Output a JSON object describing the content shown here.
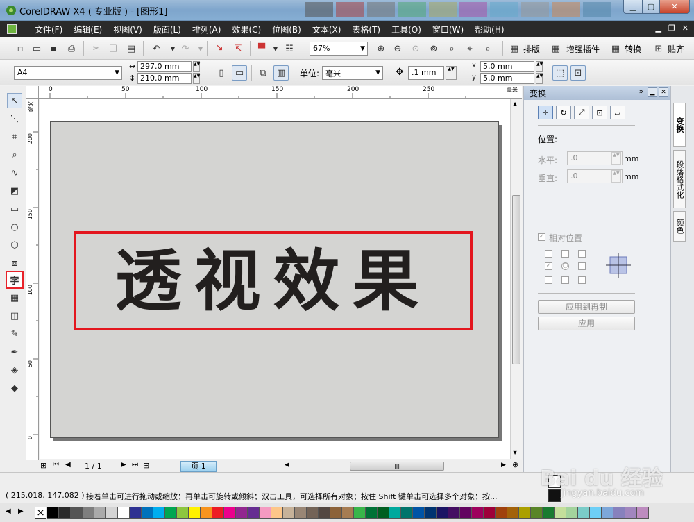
{
  "window": {
    "title": "CorelDRAW X4 ( 专业版 ) - [图形1]",
    "min_icon": "minimize-icon",
    "max_icon": "maximize-icon",
    "close_icon": "close-icon"
  },
  "menu": {
    "items": [
      "文件(F)",
      "编辑(E)",
      "视图(V)",
      "版面(L)",
      "排列(A)",
      "效果(C)",
      "位图(B)",
      "文本(X)",
      "表格(T)",
      "工具(O)",
      "窗口(W)",
      "帮助(H)"
    ]
  },
  "toolbar1": {
    "zoom": "67%",
    "buttons": {
      "layout": "排版",
      "plugins": "增强插件",
      "convert": "转换",
      "paste": "贴齐"
    }
  },
  "toolbar2": {
    "paper_size": "A4",
    "width": "297.0 mm",
    "height": "210.0 mm",
    "unit_label": "单位:",
    "unit_value": "毫米",
    "nudge": ".1 mm",
    "dup_x": "5.0 mm",
    "dup_y": "5.0 mm"
  },
  "ruler": {
    "top_ticks": [
      "0",
      "50",
      "100",
      "150",
      "200",
      "250"
    ],
    "top_unit": "毫米",
    "left_ticks": [
      "200",
      "150",
      "100",
      "50",
      "0"
    ],
    "left_unit": "毫米"
  },
  "canvas": {
    "text": "透视效果",
    "accent": "#e3161e",
    "text_color": "#221f1e",
    "page_color": "#d4d4d2"
  },
  "pages": {
    "counter": "1 / 1",
    "tab": "页 1"
  },
  "docker": {
    "title": "变换",
    "section": "位置:",
    "h_label": "水平:",
    "h_value": ".0",
    "v_label": "垂直:",
    "v_value": ".0",
    "unit": "mm",
    "relative": "相对位置",
    "apply_dup": "应用到再制",
    "apply": "应用",
    "side_tabs": [
      "变换",
      "段落格式化",
      "颜色"
    ]
  },
  "status": {
    "coords": "( 215.018, 147.082 )",
    "message": "接着单击可进行拖动或缩放；再单击可旋转或倾斜；双击工具，可选择所有对象；按住 Shift 键单击可选择多个对象；按..."
  },
  "palette": {
    "colors": [
      "#000000",
      "#2b2b2b",
      "#555555",
      "#7f7f7f",
      "#aaaaaa",
      "#d4d4d4",
      "#ffffff",
      "#2e3192",
      "#0072bc",
      "#00aeef",
      "#00a651",
      "#8dc63f",
      "#fff200",
      "#f7941d",
      "#ed1c24",
      "#ec008c",
      "#92278f",
      "#662d91",
      "#f49ac1",
      "#fdc689",
      "#c7b299",
      "#998675",
      "#736357",
      "#534741",
      "#8c6239",
      "#a67c52",
      "#39b54a",
      "#007236",
      "#005e20",
      "#00a99d",
      "#00746b",
      "#0054a6",
      "#003471",
      "#1b1464",
      "#440e62",
      "#630460",
      "#9e005d",
      "#9e0039",
      "#a0410d",
      "#a36209",
      "#aba000",
      "#598527",
      "#197b30",
      "#c4df9b",
      "#a3d39c",
      "#7accc8",
      "#6dcff6",
      "#7da7d9",
      "#8781bd",
      "#a186be",
      "#bd8cbf",
      "#f49ac2",
      "#f6989d",
      "#f9ad81",
      "#fdc68a",
      "#fff79a"
    ]
  },
  "watermark": {
    "logo": "Bai du 经验",
    "url": "jingyan.baidu.com"
  }
}
